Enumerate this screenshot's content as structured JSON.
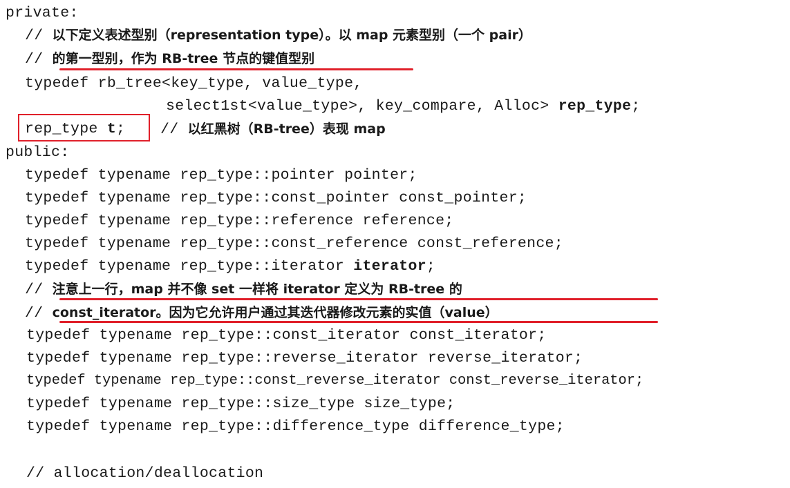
{
  "colors": {
    "text": "#1a1a1a",
    "annotation_red": "#e0202a"
  },
  "code": {
    "private_kw": "private:",
    "c1_prefix": "// ",
    "c1_text": "以下定义表述型别（representation type）。以 map 元素型别（一个 pair）",
    "c2_prefix": "// ",
    "c2_text": "的第一型别，作为 RB-tree 节点的键值型别",
    "l_typedef1": "typedef rb_tree<key_type, value_type,",
    "l_select_pre": "select1st<value_type>, key_compare, Alloc> ",
    "l_select_bold": "rep_type",
    "l_select_post": ";",
    "l_rep_pre": "rep_type ",
    "l_rep_bold": "t",
    "l_rep_post": ";",
    "l_rep_comment_prefix": "// ",
    "l_rep_comment_text": "以红黑树（RB-tree）表现 map",
    "public_kw": "public:",
    "t_pointer": "typedef typename rep_type::pointer pointer;",
    "t_const_pointer": "typedef typename rep_type::const_pointer const_pointer;",
    "t_reference": "typedef typename rep_type::reference reference;",
    "t_const_reference": "typedef typename rep_type::const_reference const_reference;",
    "t_iterator_pre": "typedef typename rep_type::iterator ",
    "t_iterator_bold": "iterator",
    "t_iterator_post": ";",
    "c3_prefix": "// ",
    "c3_text": "注意上一行，map 并不像 set 一样将 iterator 定义为 RB-tree 的",
    "c4_prefix": "// ",
    "c4_text": "const_iterator。因为它允许用户通过其迭代器修改元素的实值（value）",
    "t_const_iterator": "typedef typename rep_type::const_iterator const_iterator;",
    "t_reverse_iterator": "typedef typename rep_type::reverse_iterator reverse_iterator;",
    "t_const_reverse_iterator": "typedef typename rep_type::const_reverse_iterator const_reverse_iterator;",
    "t_size_type": "typedef typename rep_type::size_type size_type;",
    "t_difference_type": "typedef typename rep_type::difference_type difference_type;",
    "c_alloc": "// allocation/deallocation"
  }
}
